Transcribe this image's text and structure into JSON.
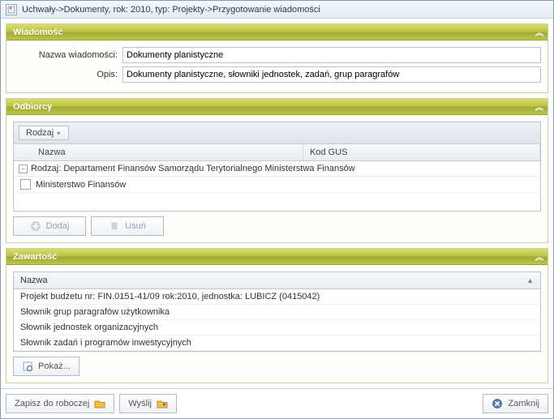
{
  "window": {
    "title": "Uchwały->Dokumenty, rok: 2010, typ: Projekty->Przygotowanie wiadomości"
  },
  "wiadomosc": {
    "header": "Wiadomość",
    "label_nazwa": "Nazwa wiadomości:",
    "nazwa": "Dokumenty planistyczne",
    "label_opis": "Opis:",
    "opis": "Dokumenty planistyczne, słowniki jednostek, zadań, grup paragrafów"
  },
  "odbiorcy": {
    "header": "Odbiorcy",
    "group_chip": "Rodzaj",
    "col_nazwa": "Nazwa",
    "col_gus": "Kod GUS",
    "group_label": "Rodzaj:  Departament Finansów Samorządu Terytorialnego Ministerstwa Finansów",
    "rows": [
      {
        "nazwa": "Ministerstwo Finansów",
        "gus": ""
      }
    ],
    "btn_add": "Dodaj",
    "btn_del": "Usuń"
  },
  "zawartosc": {
    "header": "Zawartość",
    "col_nazwa": "Nazwa",
    "rows": [
      "Projekt budżetu nr: FIN.0151-41/09 rok:2010, jednostka: LUBICZ (0415042)",
      "Słownik grup paragrafów użytkownika",
      "Słownik jednostek organizacyjnych",
      "Słownik zadań i programów inwestycyjnych"
    ],
    "btn_show": "Pokaż..."
  },
  "footer": {
    "btn_save": "Zapisz do roboczej",
    "btn_send": "Wyślij",
    "btn_close": "Zamknij"
  }
}
